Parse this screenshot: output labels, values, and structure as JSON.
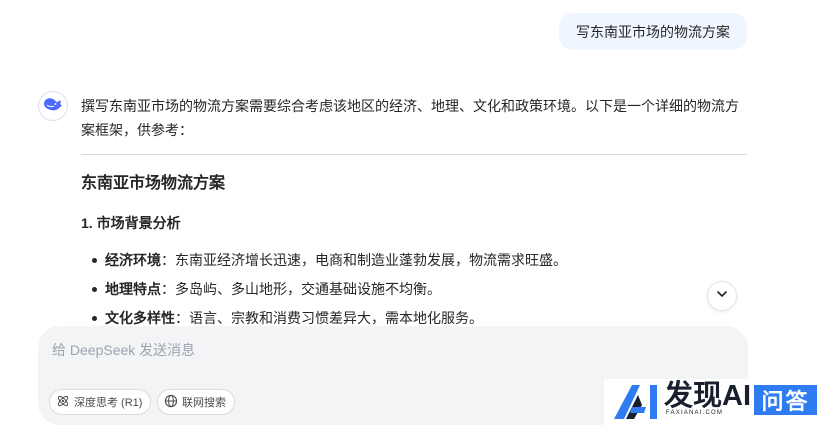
{
  "conversation": {
    "user_message": "写东南亚市场的物流方案",
    "assistant": {
      "intro": "撰写东南亚市场的物流方案需要综合考虑该地区的经济、地理、文化和政策环境。以下是一个详细的物流方案框架，供参考：",
      "heading": "东南亚市场物流方案",
      "section_title": "1. 市场背景分析",
      "bullets": [
        {
          "term": "经济环境",
          "sep": "：",
          "text": "东南亚经济增长迅速，电商和制造业蓬勃发展，物流需求旺盛。"
        },
        {
          "term": "地理特点",
          "sep": "：",
          "text": "多岛屿、多山地形，交通基础设施不均衡。"
        },
        {
          "term": "文化多样性",
          "sep": "：",
          "text": "语言、宗教和消费习惯差异大，需本地化服务。"
        }
      ]
    }
  },
  "composer": {
    "placeholder": "给 DeepSeek 发送消息",
    "value": "",
    "chips": {
      "deep_think": "深度思考 (R1)",
      "web_search": "联网搜索"
    }
  },
  "watermark": {
    "brand": "发现AI",
    "domain": "FAXIANAI.COM",
    "badge": "问答"
  },
  "icons": {
    "avatar": "deepseek-whale-icon",
    "scroll": "chevron-down-icon",
    "deep_think": "atom-icon",
    "web_search": "globe-icon"
  },
  "colors": {
    "accent": "#4d6bfe",
    "user_bubble": "#eff6ff",
    "composer_bg": "#f3f4f6",
    "badge_blue": "#2e7bf2"
  }
}
